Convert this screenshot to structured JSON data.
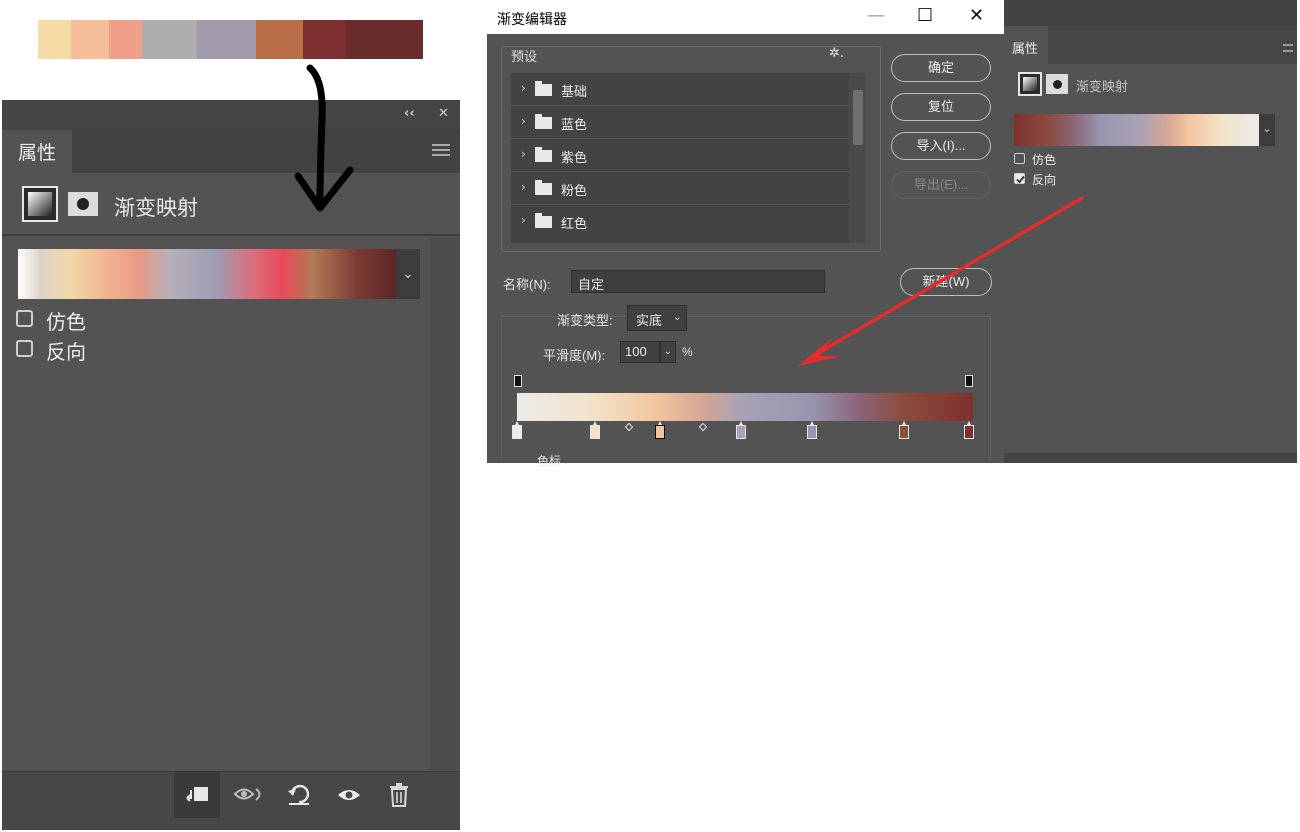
{
  "palette": {
    "swatches": [
      {
        "color": "#f5dba4",
        "w": 33
      },
      {
        "color": "#f6be98",
        "w": 38
      },
      {
        "color": "#f0a08a",
        "w": 33
      },
      {
        "color": "#afadb0",
        "w": 55
      },
      {
        "color": "#a29aab",
        "w": 59
      },
      {
        "color": "#b96e47",
        "w": 47
      },
      {
        "color": "#7d2f2f",
        "w": 43
      },
      {
        "color": "#6a2c2b",
        "w": 77
      }
    ]
  },
  "left_panel": {
    "collapse_glyph": "‹‹",
    "close_glyph": "✕",
    "tab_label": "属性",
    "title": "渐变映射",
    "dither_label": "仿色",
    "reverse_label": "反向",
    "dropdown_glyph": "⌄"
  },
  "dialog": {
    "title": "渐变编辑器",
    "minimize_glyph": "—",
    "maximize_glyph": "☐",
    "close_glyph": "✕",
    "presets_label": "预设",
    "presets_gear": "✲.",
    "preset_folders": [
      "基础",
      "蓝色",
      "紫色",
      "粉色",
      "红色"
    ],
    "buttons": {
      "ok": "确定",
      "reset": "复位",
      "import": "导入(I)...",
      "export": "导出(E)...",
      "new": "新建(W)"
    },
    "name_label": "名称(N):",
    "name_value": "自定",
    "type_label": "渐变类型:",
    "type_value": "实底",
    "smooth_label": "平滑度(M):",
    "smooth_value": "100",
    "smooth_unit": "%",
    "color_label": "色标"
  },
  "right_panel": {
    "tab_label": "属性",
    "title": "渐变映射",
    "dither_label": "仿色",
    "reverse_label": "反向",
    "reverse_checked": true
  },
  "colors": {
    "panel_bg": "#535353",
    "annotation_red": "#e52b2b"
  }
}
